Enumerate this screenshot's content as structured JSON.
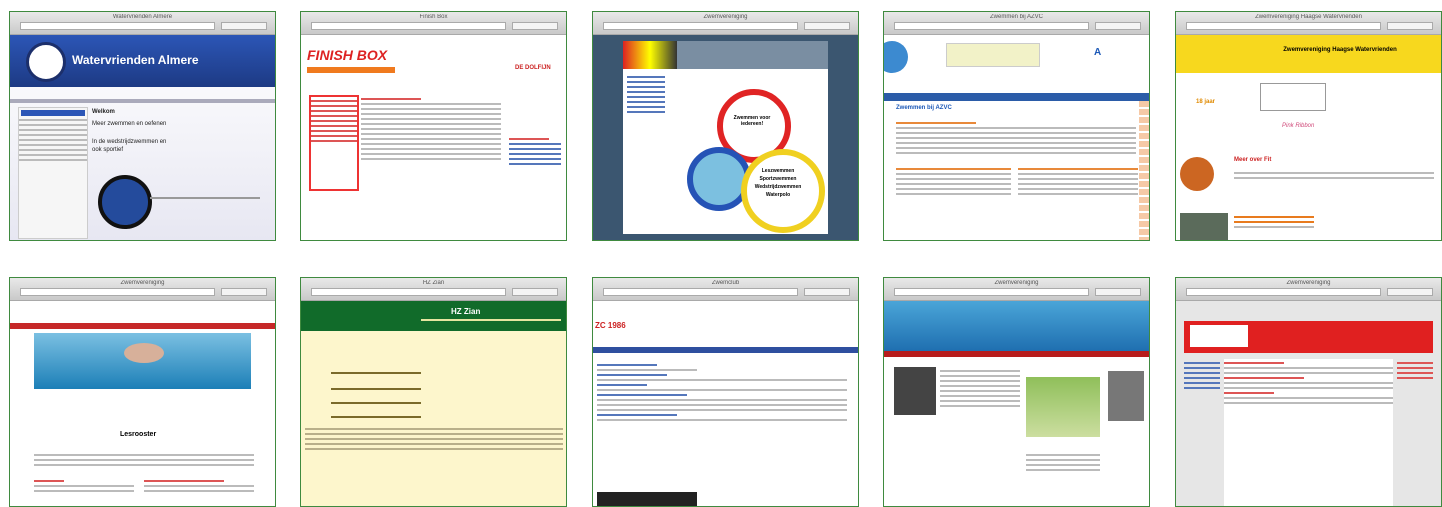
{
  "thumbnails": [
    {
      "id": "t1",
      "title": "Watervrienden Almere",
      "header": "Watervrienden Almere",
      "welcome": "Welkom",
      "line1": "Meer zwemmen en oefenen",
      "line2": "In de wedstrijdzwemmen en",
      "line3": "ook sportief"
    },
    {
      "id": "t2",
      "title": "Finish Box",
      "logo": "FINISH BOX",
      "badge": "DE DOLFIJN"
    },
    {
      "id": "t3",
      "title": "Zwemvereniging",
      "center": "Zwemmen voor iedereen!",
      "bullets": [
        "Leszwemmen",
        "Sportzwemmen",
        "Wedstrijdzwemmen",
        "Waterpolo"
      ]
    },
    {
      "id": "t4",
      "title": "Zwemmen bij AZVC",
      "heading": "Zwemmen bij AZVC"
    },
    {
      "id": "t5",
      "title": "Zwemvereniging Haagse Watervrienden",
      "org": "Zwemvereniging Haagse Watervrienden",
      "promo": "Meer over Fit",
      "age": "18 jaar",
      "pink": "Pink Ribbon"
    },
    {
      "id": "t6",
      "title": "Zwemvereniging",
      "heading": "Lesrooster"
    },
    {
      "id": "t7",
      "title": "HZ Zian",
      "header": "HZ Zian"
    },
    {
      "id": "t8",
      "title": "Zwemclub",
      "logo": "ZC 1986"
    },
    {
      "id": "t9",
      "title": "Zwemvereniging"
    },
    {
      "id": "t10",
      "title": "Zwemvereniging"
    }
  ]
}
